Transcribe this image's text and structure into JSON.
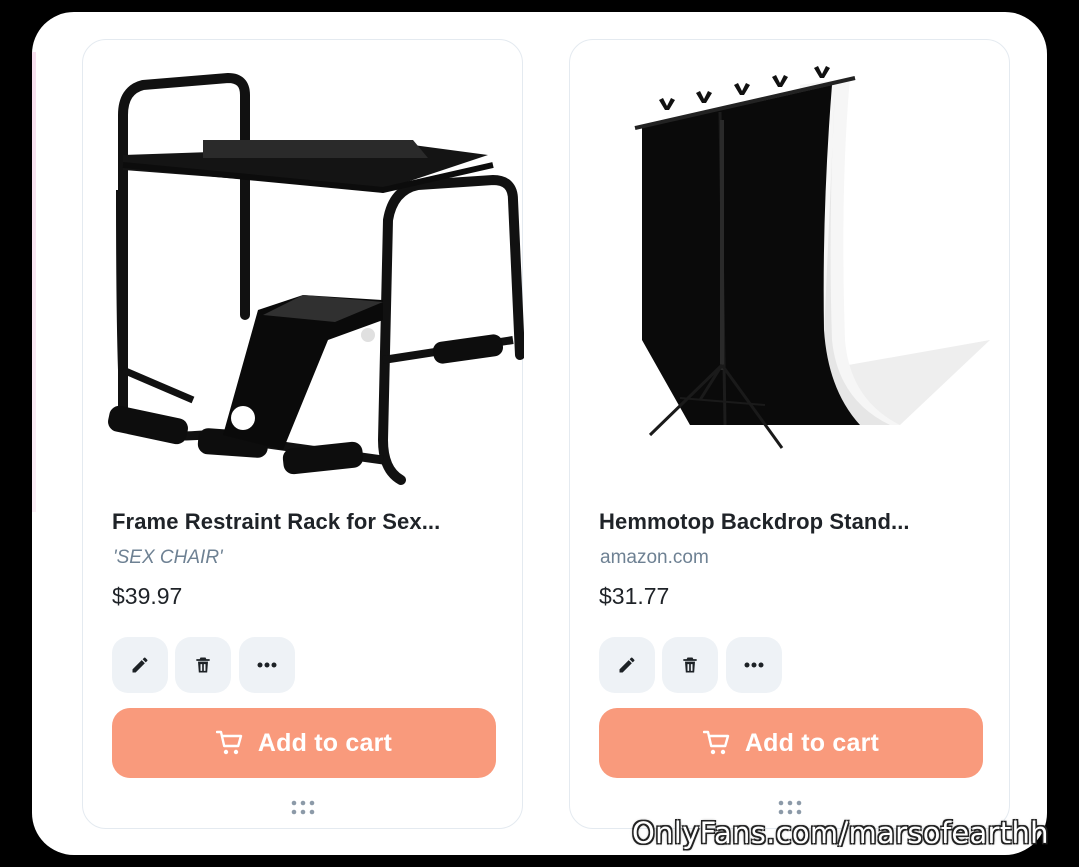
{
  "products": [
    {
      "title": "Frame Restraint Rack for Sex...",
      "source": "'SEX CHAIR'",
      "price": "$39.97",
      "image_icon": "metal-chair-frame-image",
      "actions": [
        "pencil-icon",
        "trash-icon",
        "more-horizontal-icon"
      ],
      "cart_label": "Add to cart"
    },
    {
      "title": "Hemmotop Backdrop Stand...",
      "source": "amazon.com",
      "price": "$31.77",
      "image_icon": "backdrop-stand-image",
      "actions": [
        "pencil-icon",
        "trash-icon",
        "more-horizontal-icon"
      ],
      "cart_label": "Add to cart"
    }
  ],
  "watermark": "OnlyFans.com/marsofearthh",
  "colors": {
    "background": "#000000",
    "panel": "#ffffff",
    "accent_button": "#f99a7c",
    "action_button_bg": "#eef2f6",
    "source_text": "#6e8193",
    "title_text": "#1f2328"
  }
}
